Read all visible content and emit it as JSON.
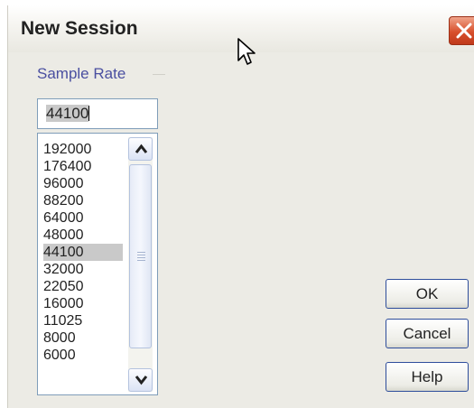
{
  "window": {
    "title": "New Session"
  },
  "sample_rate": {
    "label": "Sample Rate",
    "value": "44100",
    "options": [
      "192000",
      "176400",
      "96000",
      "88200",
      "64000",
      "48000",
      "44100",
      "32000",
      "22050",
      "16000",
      "11025",
      "8000",
      "6000"
    ],
    "selected": "44100"
  },
  "buttons": {
    "ok": "OK",
    "cancel": "Cancel",
    "help": "Help"
  },
  "colors": {
    "window_bg": "#ecebe5",
    "close": "#d8502c",
    "label": "#4a4fa0",
    "button_border": "#2e4d9b"
  },
  "icons": {
    "close": "close-icon",
    "cursor": "mouse-pointer-icon",
    "scroll_up": "chevron-up-icon",
    "scroll_down": "chevron-down-icon"
  }
}
